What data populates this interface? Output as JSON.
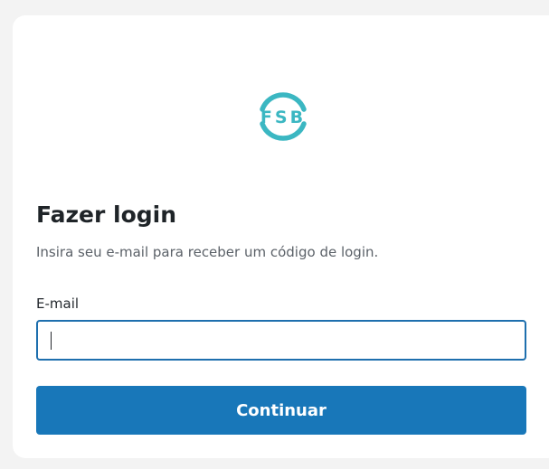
{
  "logo": {
    "text": "FSB",
    "color": "#3bb7c2",
    "icon": "fsb-logo-icon"
  },
  "login": {
    "title": "Fazer login",
    "subtitle": "Insira seu e-mail para receber um código de login.",
    "email_label": "E-mail",
    "email_value": "",
    "email_placeholder": "",
    "continue_label": "Continuar"
  },
  "colors": {
    "primary_button": "#1877b9",
    "input_focus_border": "#1e6fae",
    "page_background": "#f3f3f3",
    "card_background": "#ffffff"
  }
}
